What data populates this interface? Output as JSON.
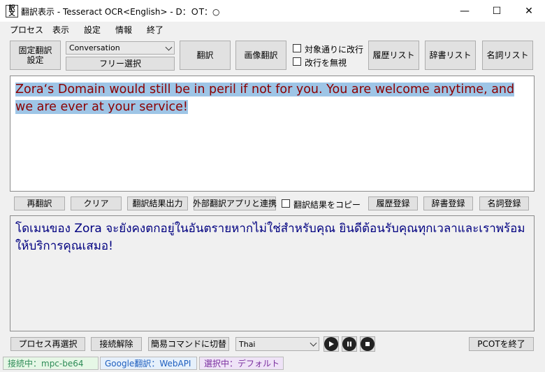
{
  "window": {
    "title": "翻訳表示 - Tesseract OCR<English> - D：ＯT：○",
    "minimize": "—",
    "maximize": "☐",
    "close": "✕"
  },
  "menu": [
    "プロセス",
    "表示",
    "設定",
    "情報",
    "終了"
  ],
  "toolbar": {
    "fixed_translation": "固定翻訳\n設定",
    "mode_value": "Conversation",
    "free_select": "フリー選択",
    "translate": "翻訳",
    "image_translate": "画像翻訳",
    "chk_newline": "対象通りに改行",
    "chk_ignore_newline": "改行を無視",
    "history_list": "履歴リスト",
    "dictionary_list": "辞書リスト",
    "noun_list": "名詞リスト"
  },
  "source_text": "Zora‘s Domain would still be in peril if not for you. You are welcome anytime, and we are ever at your service!",
  "middle_bar": {
    "retranslate": "再翻訳",
    "clear": "クリア",
    "output_result": "翻訳結果出力",
    "external_link": "外部翻訳アプリと連携",
    "copy_result": "翻訳結果をコピー",
    "history_register": "履歴登録",
    "dictionary_register": "辞書登録",
    "noun_register": "名詞登録"
  },
  "target_text": "โดเมนของ Zora จะยังคงตกอยู่ในอันตรายหากไม่ใช่สำหรับคุณ ยินดีต้อนรับคุณทุกเวลาและเราพร้อมให้บริการคุณเสมอ!",
  "bottom_bar": {
    "reselect_process": "プロセス再選択",
    "disconnect": "接続解除",
    "simple_command": "簡易コマンドに切替",
    "language_value": "Thai",
    "exit_pcot": "PCOTを終了"
  },
  "status": {
    "connection": "接続中：mpc-be64",
    "engine": "Google翻訳：WebAPI",
    "selection": "選択中：デフォルト"
  },
  "colors": {
    "source_text": "#8b0000",
    "source_highlight": "#9ec5e6",
    "target_text": "#000080",
    "status_connection_bg": "#e6f7e6",
    "status_engine_bg": "#e6f0fb",
    "status_selection_bg": "#efe3f7"
  },
  "icons": {
    "play": "play-icon",
    "pause": "pause-icon",
    "stop": "stop-icon"
  }
}
